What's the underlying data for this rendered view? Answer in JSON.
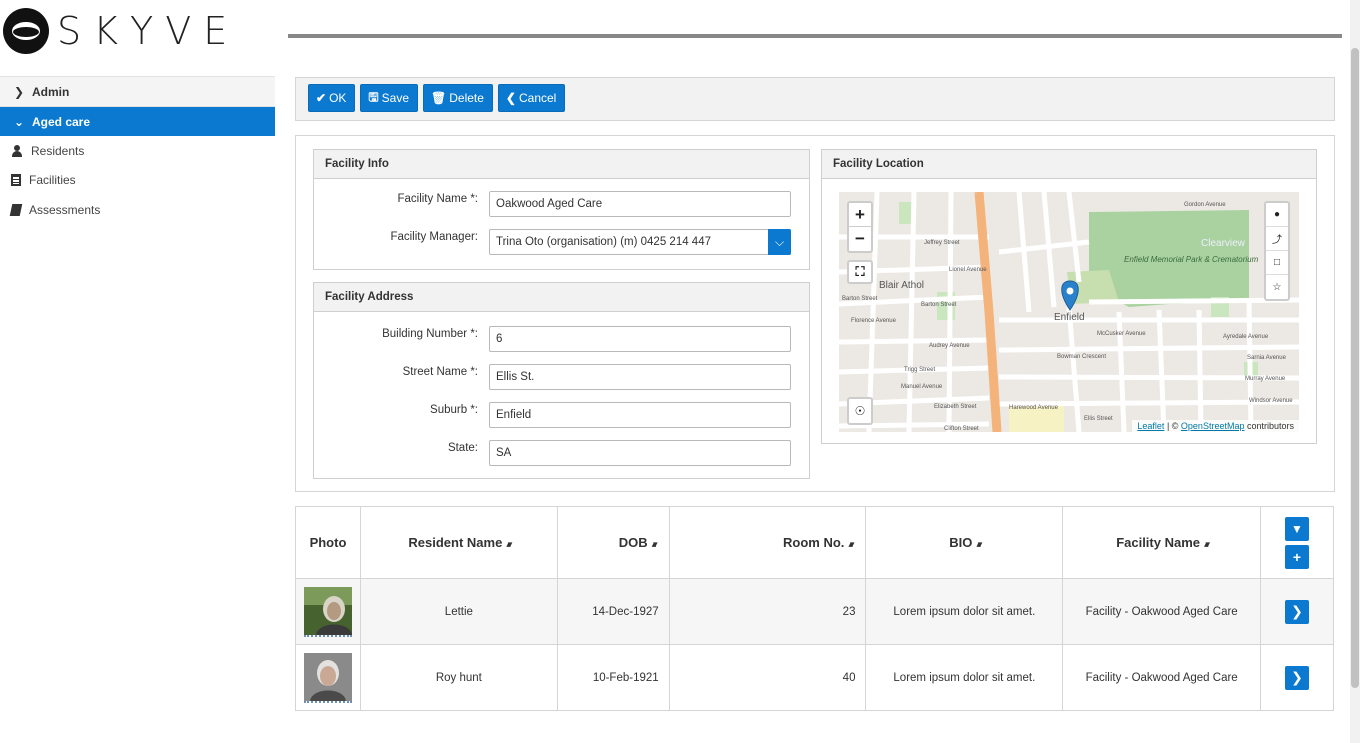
{
  "brand": {
    "name": "SKYVE"
  },
  "sidebar": {
    "groups": [
      {
        "label": "Admin",
        "expanded": false
      },
      {
        "label": "Aged care",
        "expanded": true
      }
    ],
    "items": [
      {
        "label": "Residents",
        "icon": "person-icon"
      },
      {
        "label": "Facilities",
        "icon": "building-icon"
      },
      {
        "label": "Assessments",
        "icon": "book-icon"
      }
    ]
  },
  "toolbar": {
    "ok_label": "OK",
    "save_label": "Save",
    "delete_label": "Delete",
    "cancel_label": "Cancel"
  },
  "facility_info": {
    "title": "Facility Info",
    "name_label": "Facility Name *:",
    "name_value": "Oakwood Aged Care",
    "manager_label": "Facility Manager:",
    "manager_value": "Trina Oto (organisation) (m) 0425 214 447"
  },
  "facility_address": {
    "title": "Facility Address",
    "building_label": "Building Number *:",
    "building_value": "6",
    "street_label": "Street Name *:",
    "street_value": "Ellis St.",
    "suburb_label": "Suburb *:",
    "suburb_value": "Enfield",
    "state_label": "State:",
    "state_value": "SA"
  },
  "facility_location": {
    "title": "Facility Location",
    "map": {
      "zoom_in": "+",
      "zoom_out": "−",
      "labels": {
        "blair_athol": "Blair Athol",
        "enfield": "Enfield",
        "clearview": "Clearview",
        "cemetery": "Enfield Memorial Park & Crematorium",
        "audrey": "Audrey Avenue",
        "barton": "Barton Street",
        "mccusker": "McCusker Avenue",
        "ayredale": "Ayredale Avenue",
        "murray": "Murray Avenue",
        "windsor": "Windsor Avenue",
        "harewood": "Harewood Avenue",
        "ellis": "Ellis Street",
        "elizabeth": "Elizabeth Street",
        "manuel": "Manuel Avenue",
        "trigg": "Trigg Street",
        "florence": "Florence Avenue",
        "gordon": "Gordon Avenue",
        "bowman": "Bowman Crescent",
        "sarnia": "Sarnia Avenue",
        "clifton": "Clifton Street",
        "jeffrey": "Jeffrey Street",
        "lionel": "Lionel Avenue"
      },
      "attribution_leaflet": "Leaflet",
      "attribution_sep": " | © ",
      "attribution_osm": "OpenStreetMap",
      "attribution_tail": " contributors"
    }
  },
  "residents_table": {
    "columns": [
      "Photo",
      "Resident Name",
      "DOB",
      "Room No.",
      "BIO",
      "Facility Name"
    ],
    "rows": [
      {
        "name": "Lettie",
        "dob": "14-Dec-1927",
        "room": "23",
        "bio": "Lorem ipsum dolor sit amet.",
        "facility": "Facility - Oakwood Aged Care"
      },
      {
        "name": "Roy hunt",
        "dob": "10-Feb-1921",
        "room": "40",
        "bio": "Lorem ipsum dolor sit amet.",
        "facility": "Facility - Oakwood Aged Care"
      }
    ]
  },
  "colors": {
    "accent": "#0b79d0",
    "panel_header": "#f2f2f2",
    "border": "#d5d5d5"
  }
}
